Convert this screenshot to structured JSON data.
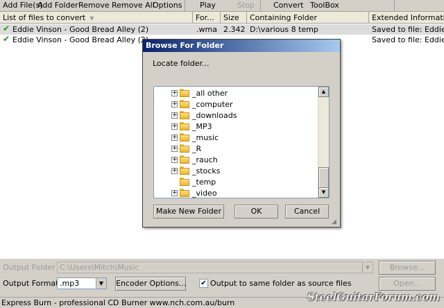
{
  "toolbar": {
    "add_files": "Add File(s)",
    "add_folder": "Add Folder",
    "remove": "Remove",
    "remove_all": "Remove All",
    "options": "Options",
    "play": "Play",
    "stop": "Stop",
    "convert": "Convert",
    "toolbox": "ToolBox"
  },
  "list": {
    "columns": {
      "files": "List of files to convert",
      "format": "For...",
      "size": "Size",
      "folder": "Containing Folder",
      "info": "Extended Information"
    },
    "rows": [
      {
        "name": "Eddie Vinson - Good Bread Alley (2)",
        "format": ".wma",
        "size": "2.342",
        "folder": "D:\\various 8 temp",
        "info": "Saved to file: Eddie Vinsc"
      },
      {
        "name": "Eddie Vinson - Good Bread Alley (2)",
        "format": "",
        "size": "",
        "folder": "",
        "info": "Saved to file: Eddie Vinsc"
      }
    ]
  },
  "dialog": {
    "title": "Browse For Folder",
    "prompt": "Locate folder...",
    "folders": [
      {
        "label": "_all other",
        "expandable": true
      },
      {
        "label": "_computer",
        "expandable": true
      },
      {
        "label": "_downloads",
        "expandable": true
      },
      {
        "label": "_MP3",
        "expandable": true
      },
      {
        "label": "_music",
        "expandable": true
      },
      {
        "label": "_R",
        "expandable": true
      },
      {
        "label": "_rauch",
        "expandable": true
      },
      {
        "label": "_stocks",
        "expandable": true
      },
      {
        "label": "_temp",
        "expandable": false
      },
      {
        "label": "_video",
        "expandable": true
      }
    ],
    "make_new_folder": "Make New Folder",
    "ok": "OK",
    "cancel": "Cancel"
  },
  "bottom": {
    "output_folder_label": "Output Folder",
    "output_folder_value": "C:\\Users\\Mitch\\Music",
    "browse": "Browse...",
    "output_format_label": "Output Format",
    "output_format_value": ".mp3",
    "encoder_options": "Encoder Options...",
    "same_folder_label": "Output to same folder as source files",
    "same_folder_checked": true,
    "open": "Open..."
  },
  "status": {
    "text": "Express Burn - professional CD Burner www.nch.com.au/burn"
  },
  "watermark": "SteelGuitarForum.com"
}
